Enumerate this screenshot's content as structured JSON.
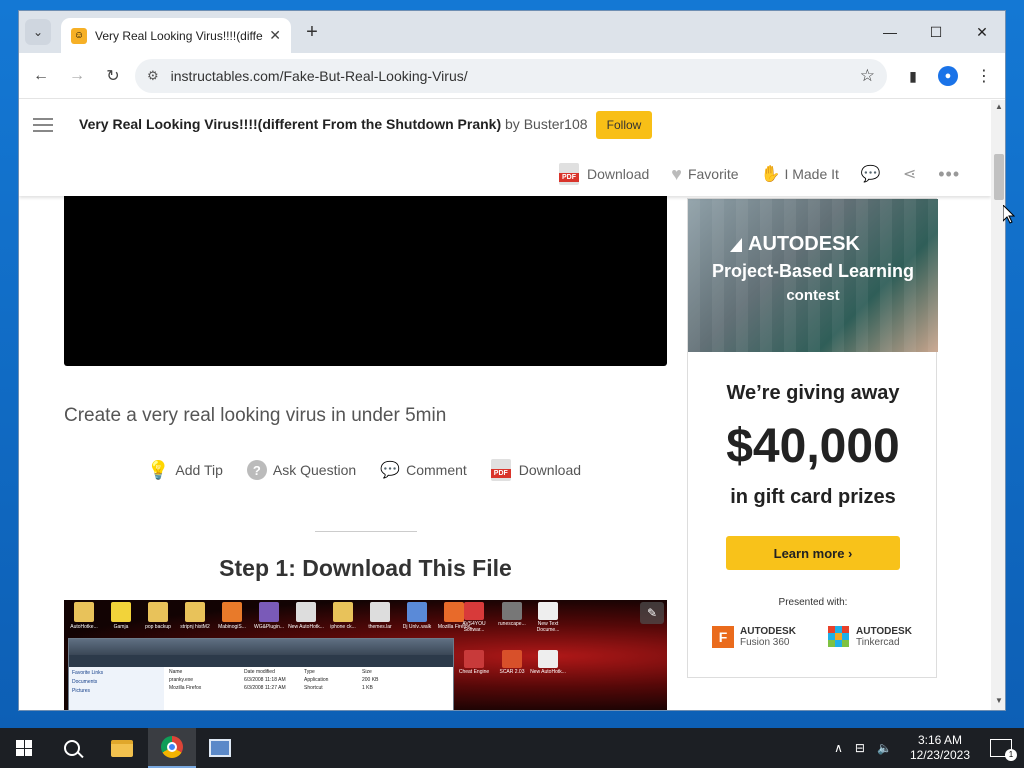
{
  "browser": {
    "tab_title": "Very Real Looking Virus!!!!(diffe",
    "tab_close": "✕",
    "new_tab": "+",
    "url": "instructables.com/Fake-But-Real-Looking-Virus/"
  },
  "header": {
    "title": "Very Real Looking Virus!!!!(different From the Shutdown Prank)",
    "by_label": "by",
    "author": "Buster108",
    "follow_label": "Follow",
    "actions": {
      "download": "Download",
      "favorite": "Favorite",
      "made_it": "I Made It"
    }
  },
  "content": {
    "intro": "Create a very real looking virus in under 5min",
    "step_actions": {
      "add_tip": "Add Tip",
      "ask_question": "Ask Question",
      "comment": "Comment",
      "download": "Download"
    },
    "step_title": "Step 1: Download This File",
    "screenshot_icons": [
      "AutoHotke...",
      "Gamja",
      "pop backup",
      "stripnj histM2",
      "MabinogiS...",
      "WG&Plugin...",
      "New AutoHotk...",
      "iphone ck...",
      "themes.lar",
      "Dj Unlv..walk",
      "Mozilla Firefox"
    ],
    "screenshot_right_icons": [
      "AVS4YOU Softwar...",
      "runescape...",
      "New Text Docume...",
      "Cheat Engine",
      "SCAR 2.03",
      "New AutoHotk..."
    ],
    "explorer_sidebar": [
      "Favorite Links",
      "Documents",
      "Pictures"
    ],
    "explorer_columns": [
      "Name",
      "Date modified",
      "Type",
      "Size"
    ],
    "explorer_rows": [
      [
        "pranky.exe",
        "6/3/2008 11:18 AM",
        "Application",
        "200 KB"
      ],
      [
        "Mozilla Firefox",
        "6/3/2008 11:27 AM",
        "Shortcut",
        "1 KB"
      ]
    ]
  },
  "ad": {
    "brand": "AUTODESK",
    "line1": "Project-Based Learning",
    "line2": "contest",
    "giving": "We’re giving away",
    "amount": "$40,000",
    "prizes": "in gift card prizes",
    "button": "Learn more ›",
    "presented": "Presented with:",
    "logo1_brand": "AUTODESK",
    "logo1_product": "Fusion 360",
    "logo2_brand": "AUTODESK",
    "logo2_product": "Tinkercad"
  },
  "taskbar": {
    "time": "3:16 AM",
    "date": "12/23/2023",
    "notifications": "1"
  }
}
